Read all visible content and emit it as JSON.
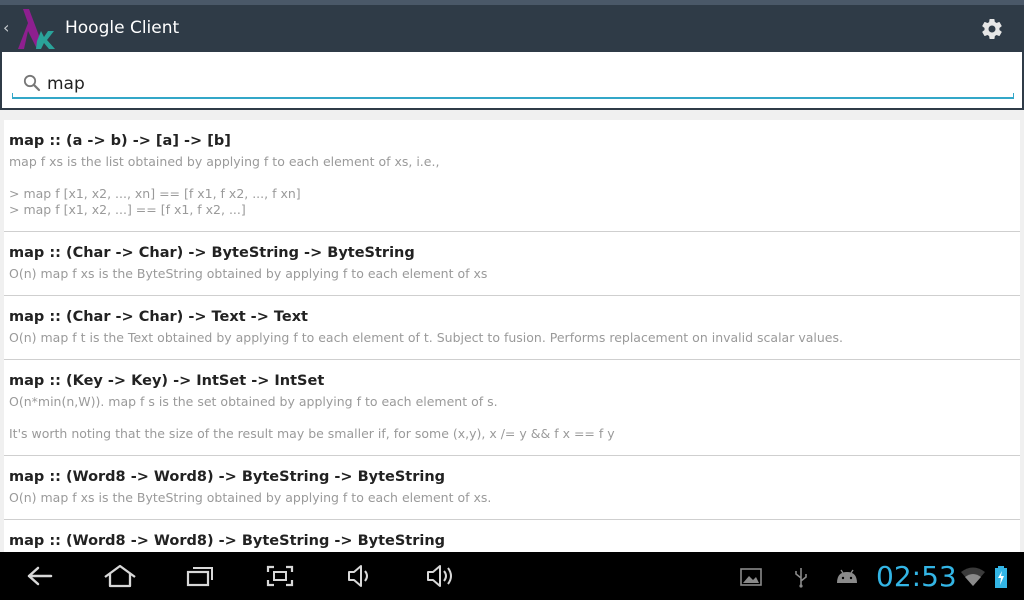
{
  "app": {
    "title": "Hoogle Client",
    "accent": "#33a7c8",
    "actionbar_color": "#2f3b47"
  },
  "actionbar": {
    "back_glyph": "‹",
    "logo_icon": "hoogle-lambda-logo-icon",
    "settings_icon": "gear-icon"
  },
  "search": {
    "value": "map",
    "icon": "search-icon"
  },
  "results": [
    {
      "signature": "map :: (a -> b) -> [a] -> [b]",
      "lines": [
        "map f xs is the list obtained by applying f to each element of xs, i.e.,",
        "> map f [x1, x2, ..., xn] == [f x1, f x2, ..., f xn]",
        "> map f [x1, x2, ...] == [f x1, f x2, ...]"
      ]
    },
    {
      "signature": "map :: (Char -> Char) -> ByteString -> ByteString",
      "lines": [
        "O(n) map f xs is the ByteString obtained by applying f to each element of xs"
      ]
    },
    {
      "signature": "map :: (Char -> Char) -> Text -> Text",
      "lines": [
        "O(n) map f t is the Text obtained by applying f to each element of t. Subject to fusion. Performs replacement on invalid scalar values."
      ]
    },
    {
      "signature": "map :: (Key -> Key) -> IntSet -> IntSet",
      "lines": [
        "O(n*min(n,W)). map f s is the set obtained by applying f to each element of s.",
        "It's worth noting that the size of the result may be smaller if, for some (x,y), x /= y && f x == f y"
      ]
    },
    {
      "signature": "map :: (Word8 -> Word8) -> ByteString -> ByteString",
      "lines": [
        "O(n) map f xs is the ByteString obtained by applying f to each element of xs."
      ]
    },
    {
      "signature": "map :: (Word8 -> Word8) -> ByteString -> ByteString",
      "lines": []
    }
  ],
  "navbar": {
    "buttons": [
      "back-icon",
      "home-icon",
      "recent-apps-icon",
      "screenshot-icon",
      "volume-down-icon",
      "volume-up-icon"
    ],
    "tray": [
      "gallery-notification-icon",
      "usb-icon",
      "android-debug-icon"
    ],
    "clock": "02:53",
    "clock_color": "#33b5e5",
    "status": [
      "wifi-icon",
      "battery-charging-icon"
    ]
  }
}
